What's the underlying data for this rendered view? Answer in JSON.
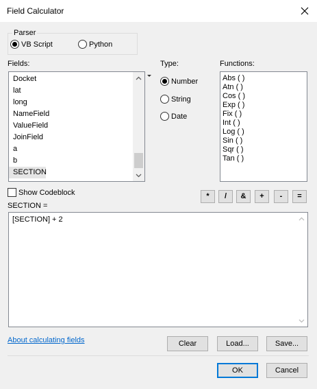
{
  "window": {
    "title": "Field Calculator",
    "close_icon": "close-icon"
  },
  "parser": {
    "label": "Parser",
    "options": [
      {
        "label": "VB Script",
        "selected": true
      },
      {
        "label": "Python",
        "selected": false
      }
    ]
  },
  "fields": {
    "label": "Fields:",
    "items": [
      "Docket",
      "lat",
      "long",
      "NameField",
      "ValueField",
      "JoinField",
      "a",
      "b",
      "SECTION"
    ],
    "selected": "SECTION"
  },
  "type": {
    "label": "Type:",
    "options": [
      {
        "label": "Number",
        "selected": true
      },
      {
        "label": "String",
        "selected": false
      },
      {
        "label": "Date",
        "selected": false
      }
    ]
  },
  "functions": {
    "label": "Functions:",
    "items": [
      "Abs ( )",
      "Atn ( )",
      "Cos ( )",
      "Exp ( )",
      "Fix ( )",
      "Int ( )",
      "Log ( )",
      "Sin ( )",
      "Sqr ( )",
      "Tan ( )"
    ]
  },
  "codeblock": {
    "label": "Show Codeblock",
    "checked": false
  },
  "operators": [
    "*",
    "/",
    "&",
    "+",
    "-",
    "="
  ],
  "expression": {
    "label": "SECTION =",
    "value": "[SECTION] + 2"
  },
  "help_link": "About calculating fields",
  "buttons": {
    "clear": "Clear",
    "load": "Load...",
    "save": "Save...",
    "ok": "OK",
    "cancel": "Cancel"
  },
  "colors": {
    "link": "#0066cc",
    "default_button_border": "#0078d7"
  }
}
